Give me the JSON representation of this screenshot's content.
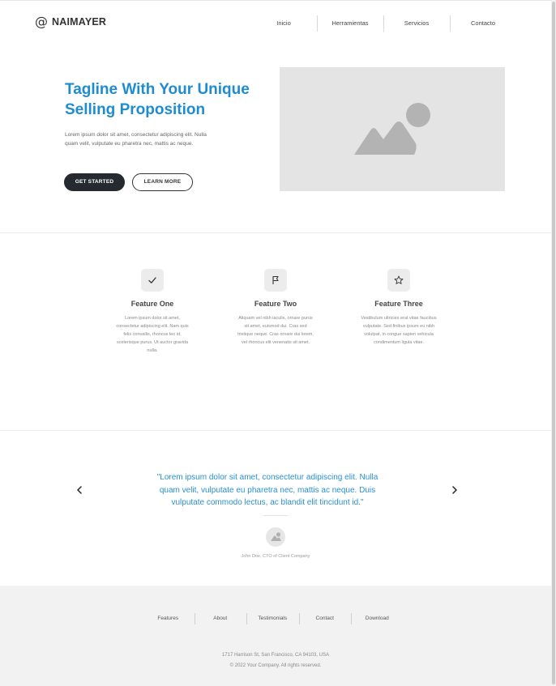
{
  "header": {
    "logo_symbol": "@",
    "brand": "NAIMAYER",
    "nav": [
      "Inicio",
      "Herramientas",
      "Servicios",
      "Contacto"
    ]
  },
  "hero": {
    "title": "Tagline With Your Unique Selling Proposition",
    "text": "Lorem ipsum dolor sit amet, consectetur adipiscing elit. Nulla quam velit, vulputate eu pharetra nec, mattis ac neque.",
    "primary_button": "GET STARTED",
    "secondary_button": "LEARN MORE",
    "image_icon": "image-placeholder-icon"
  },
  "features": [
    {
      "icon": "check-icon",
      "title": "Feature One",
      "text": "Lorem ipsum dolor sit amet, consectetur adipiscing elit. Nam quis felis convallis, rhoncus leo id, scelerisque purus. Ut auctor gravida nulla."
    },
    {
      "icon": "flag-icon",
      "title": "Feature Two",
      "text": "Aliquam vel nibh iaculis, ornare purus sit amet, euismod dui. Cras sed tristique neque. Cras ornare dui lorem, vel rhoncus elit venenatis sit amet."
    },
    {
      "icon": "star-icon",
      "title": "Feature Three",
      "text": "Vestibulum ultricies erat vitae faucibus vulputate. Sed finibus ipsum eu nibh volutpat, in congue sapien vehicula condimentum ligula vitae."
    }
  ],
  "testimonial": {
    "quote": "\"Lorem ipsum dolor sit amet, consectetur adipiscing elit. Nulla quam velit, vulputate eu pharetra nec, mattis ac neque. Duis vulputate commodo lectus, ac blandit elit tincidunt id.\"",
    "author": "John Doe, CTO of Client Company",
    "prev_icon": "chevron-left-icon",
    "next_icon": "chevron-right-icon"
  },
  "footer": {
    "nav": [
      "Features",
      "About",
      "Testimonials",
      "Contact",
      "Download"
    ],
    "address": "1717 Harrison St, San Francisco, CA 94103, USA",
    "copyright": "© 2022 Your Company.  All rights reserved."
  },
  "colors": {
    "accent": "#1f8cd1",
    "dark_button": "#262a30",
    "placeholder_gray": "#e4e4e4",
    "footer_bg": "#f2f2f2"
  }
}
